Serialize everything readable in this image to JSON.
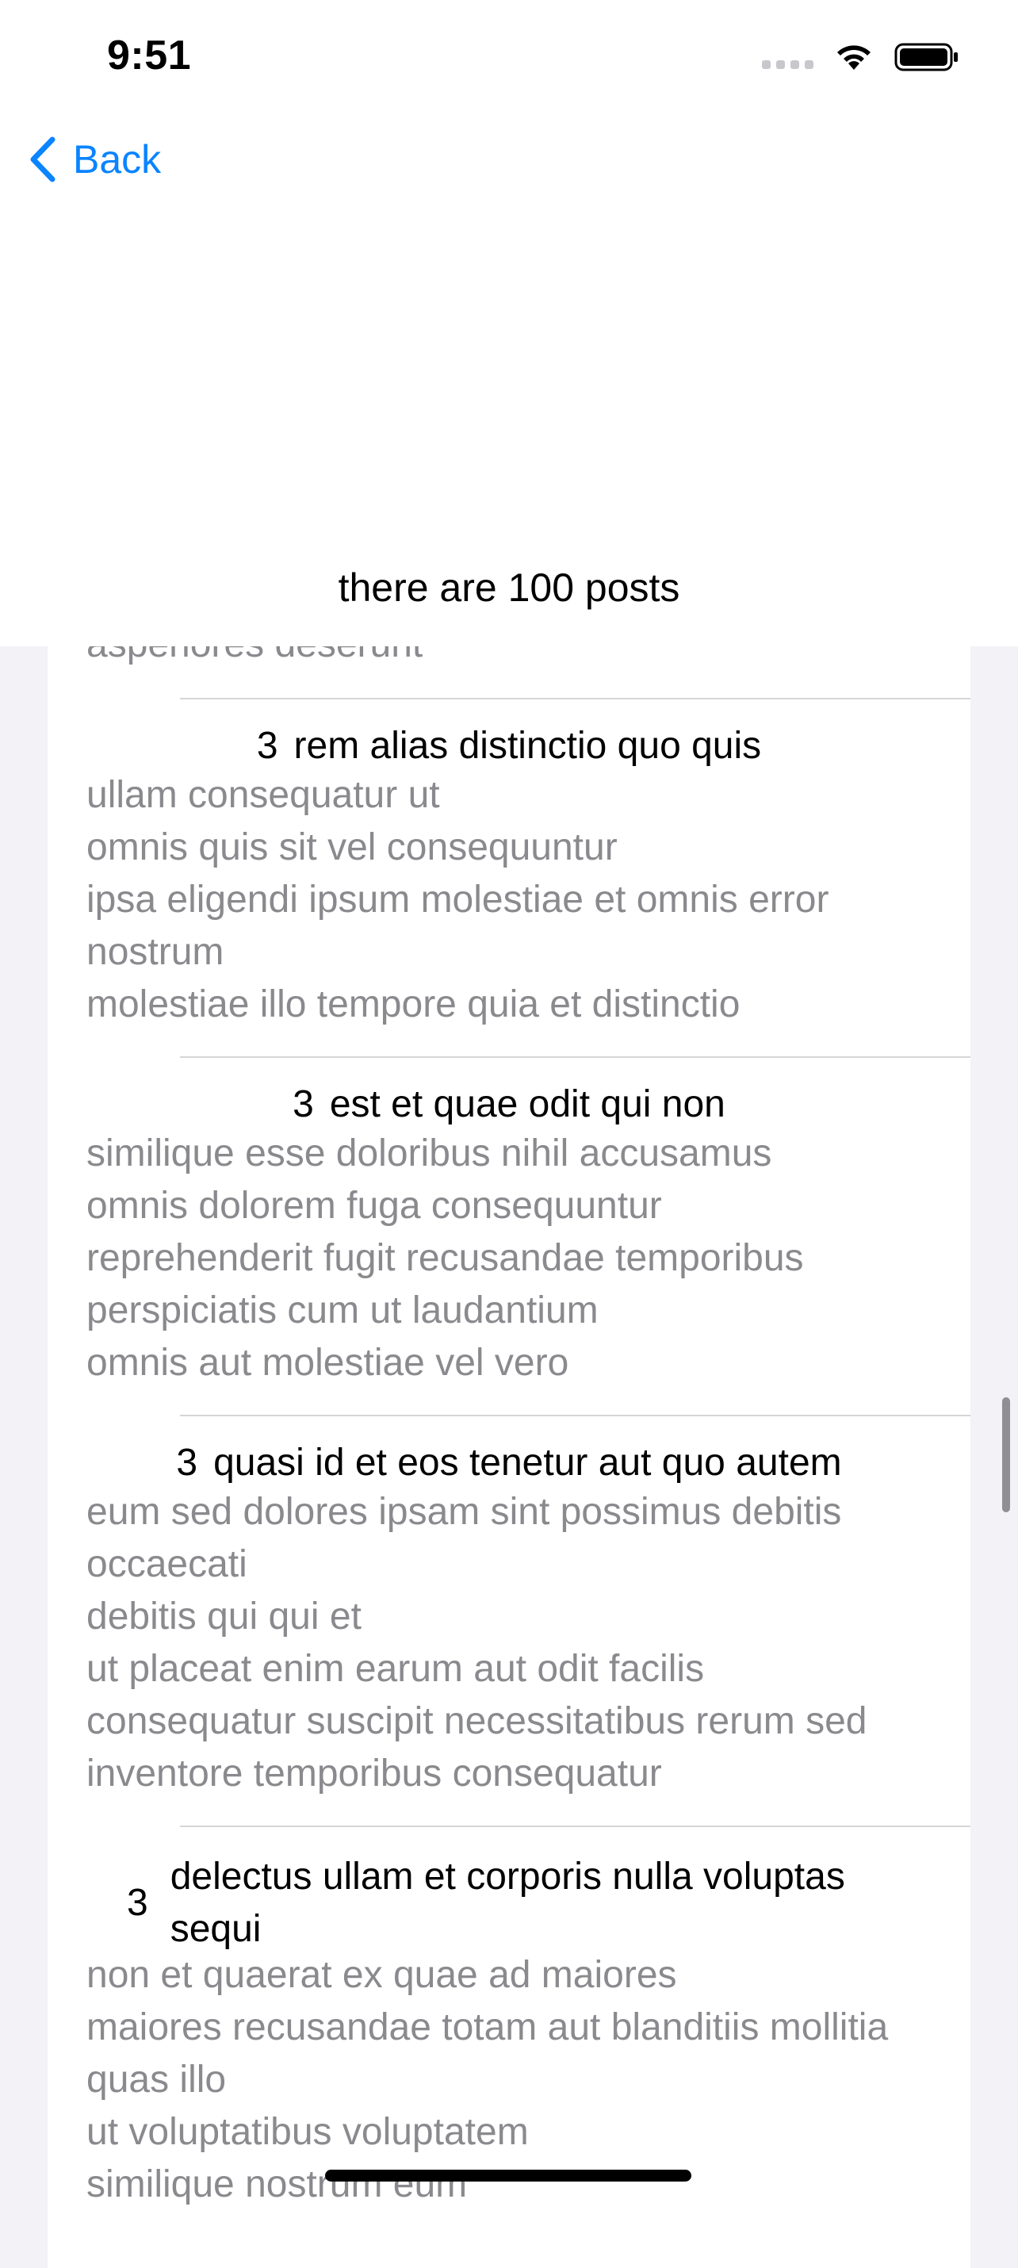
{
  "status_bar": {
    "time": "9:51",
    "signal_icon": "cellular-dots-icon",
    "wifi_icon": "wifi-icon",
    "battery_icon": "battery-full-icon"
  },
  "nav": {
    "back_label": "Back",
    "back_icon": "chevron-left-icon"
  },
  "header": {
    "post_count_text": "there are 100 posts"
  },
  "list": {
    "partial_line": "asperiores deserunt",
    "posts": [
      {
        "user_id": "3",
        "title": "rem alias distinctio quo quis",
        "body": [
          "ullam consequatur ut",
          "omnis quis sit vel consequuntur",
          "ipsa eligendi ipsum molestiae et omnis error",
          "nostrum",
          "molestiae illo tempore quia et distinctio"
        ]
      },
      {
        "user_id": "3",
        "title": "est et quae odit qui non",
        "body": [
          "similique esse doloribus nihil accusamus",
          "omnis dolorem fuga consequuntur",
          "reprehenderit fugit recusandae temporibus",
          "perspiciatis cum ut laudantium",
          "omnis aut molestiae vel vero"
        ]
      },
      {
        "user_id": "3",
        "title": "quasi id et eos tenetur aut quo autem",
        "body": [
          "eum sed dolores ipsam sint possimus debitis",
          "occaecati",
          "debitis qui qui et",
          "ut placeat enim earum aut odit facilis",
          "consequatur suscipit necessitatibus rerum sed",
          "inventore temporibus consequatur"
        ]
      },
      {
        "user_id": "3",
        "title_lines": [
          "delectus ullam et corporis nulla voluptas",
          "sequi"
        ],
        "body": [
          "non et quaerat ex quae ad maiores",
          "maiores recusandae totam aut blanditiis mollitia",
          "quas illo",
          "ut voluptatibus voluptatem",
          "similique nostrum eum"
        ]
      }
    ]
  }
}
